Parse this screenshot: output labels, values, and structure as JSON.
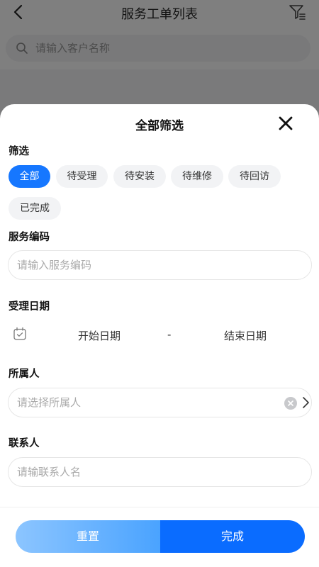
{
  "nav": {
    "title": "服务工单列表"
  },
  "search": {
    "placeholder": "请输入客户名称"
  },
  "sheet": {
    "title": "全部筛选",
    "filter_label": "筛选",
    "chips": [
      "全部",
      "待受理",
      "待安装",
      "待维修",
      "待回访",
      "已完成"
    ],
    "active_chip": "全部",
    "service_code": {
      "label": "服务编码",
      "placeholder": "请输入服务编码"
    },
    "date": {
      "label": "受理日期",
      "start": "开始日期",
      "separator": "-",
      "end": "结束日期"
    },
    "owner": {
      "label": "所属人",
      "placeholder": "请选择所属人"
    },
    "contact": {
      "label": "联系人",
      "placeholder": "请输联系人名"
    },
    "buttons": {
      "reset": "重置",
      "done": "完成"
    }
  },
  "colors": {
    "accent": "#1677ff",
    "primary_button": "#0a6cff",
    "reset_gradient_start": "#8cc5ff"
  },
  "icons": [
    "back-arrow-icon",
    "filter-icon",
    "search-icon",
    "close-icon",
    "calendar-icon",
    "clear-icon",
    "chevron-right-icon"
  ]
}
